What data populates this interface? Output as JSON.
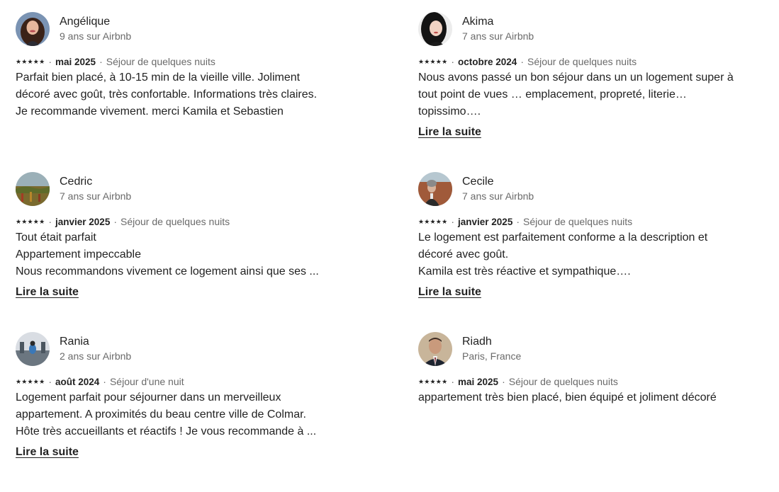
{
  "reviews": [
    {
      "name": "Angélique",
      "tenure": "9 ans sur Airbnb",
      "stars": "★★★★★",
      "date": "mai 2025",
      "stay": "Séjour de quelques nuits",
      "lines": [
        "Parfait bien placé, à 10-15 min de la vieille ville. Joliment",
        "décoré avec goût, très confortable. Informations très claires.",
        "Je recommande vivement. merci Kamila et Sebastien"
      ],
      "more": ""
    },
    {
      "name": "Akima",
      "tenure": "7 ans sur Airbnb",
      "stars": "★★★★★",
      "date": "octobre 2024",
      "stay": "Séjour de quelques nuits",
      "lines": [
        "Nous avons passé un bon séjour dans un un logement super à",
        "tout point de vues … emplacement, propreté, literie…",
        "topissimo…."
      ],
      "more": "Lire la suite"
    },
    {
      "name": "Cedric",
      "tenure": "7 ans sur Airbnb",
      "stars": "★★★★★",
      "date": "janvier 2025",
      "stay": "Séjour de quelques nuits",
      "lines": [
        "Tout était parfait",
        "Appartement impeccable",
        "Nous recommandons vivement ce logement ainsi que ses ..."
      ],
      "more": "Lire la suite"
    },
    {
      "name": "Cecile",
      "tenure": "7 ans sur Airbnb",
      "stars": "★★★★★",
      "date": "janvier 2025",
      "stay": "Séjour de quelques nuits",
      "lines": [
        "Le logement est parfaitement conforme a la description et",
        "décoré avec goût.",
        "Kamila est très réactive et sympathique…."
      ],
      "more": "Lire la suite"
    },
    {
      "name": "Rania",
      "tenure": "2 ans sur Airbnb",
      "stars": "★★★★★",
      "date": "août 2024",
      "stay": "Séjour d'une nuit",
      "lines": [
        "Logement parfait pour séjourner dans un merveilleux",
        "appartement. A proximités du beau centre ville de Colmar.",
        "Hôte très accueillants et réactifs ! Je vous recommande à ..."
      ],
      "more": "Lire la suite"
    },
    {
      "name": "Riadh",
      "tenure": "Paris, France",
      "stars": "★★★★★",
      "date": "mai 2025",
      "stay": "Séjour de quelques nuits",
      "lines": [
        "appartement très bien placé, bien équipé et joliment décoré"
      ],
      "more": ""
    }
  ]
}
